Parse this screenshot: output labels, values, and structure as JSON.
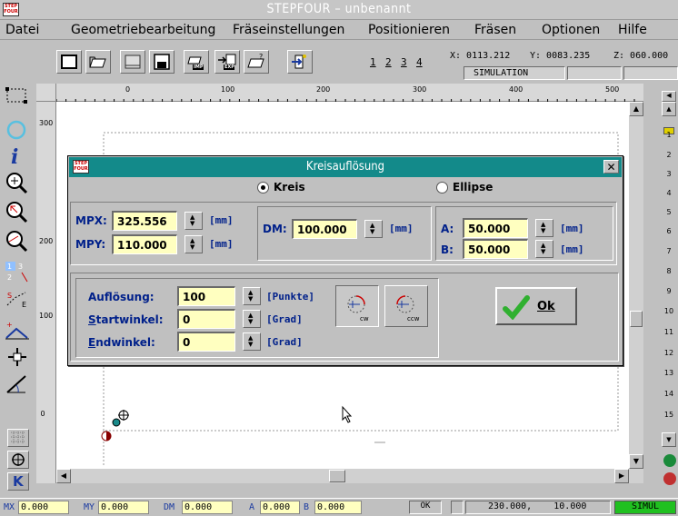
{
  "window": {
    "title": "STEPFOUR – unbenannt",
    "logo_text": "STEP FOUR"
  },
  "menu": [
    "Datei",
    "Geometriebearbeitung",
    "Fräseinstellungen",
    "Positionieren",
    "Fräsen",
    "Optionen",
    "Hilfe"
  ],
  "toolbar": {
    "page_numbers": [
      "1",
      "2",
      "3",
      "4"
    ],
    "imp_label": "IMP",
    "exp_label": "EXP",
    "coord_x": "X: 0113.212",
    "coord_y": "Y: 0083.235",
    "coord_z": "Z: 060.000",
    "mode": "SIMULATION"
  },
  "ruler": {
    "h_ticks": [
      "0",
      "100",
      "200",
      "300",
      "400",
      "500"
    ],
    "v_ticks": [
      "300",
      "200",
      "100",
      "0"
    ]
  },
  "right_numbers": [
    "1",
    "2",
    "3",
    "4",
    "5",
    "6",
    "7",
    "8",
    "9",
    "10",
    "11",
    "12",
    "13",
    "14",
    "15"
  ],
  "dialog": {
    "title": "Kreisauflösung",
    "logo_text": "STEP FOUR",
    "close": "✕",
    "radio_kreis": "Kreis",
    "radio_ellipse": "Ellipse",
    "mpx_label": "MPX:",
    "mpx_value": "325.556",
    "mpy_label": "MPY:",
    "mpy_value": "110.000",
    "unit_mm": "[mm]",
    "dm_label": "DM:",
    "dm_value": "100.000",
    "a_label": "A:",
    "a_value": "50.000",
    "b_label": "B:",
    "b_value": "50.000",
    "aufl_label": "Auflösung:",
    "aufl_value": "100",
    "aufl_unit": "[Punkte]",
    "start_label": "Startwinkel:",
    "start_value": "0",
    "end_label": "Endwinkel:",
    "end_value": "0",
    "unit_grad": "[Grad]",
    "cw": "cw",
    "ccw": "ccw",
    "ok": "Ok"
  },
  "status": {
    "mx_label": "MX",
    "mx_value": "0.000",
    "my_label": "MY",
    "my_value": "0.000",
    "dm_label": "DM",
    "dm_value": "0.000",
    "a_label": "A",
    "a_value": "0.000",
    "b_label": "B",
    "b_value": "0.000",
    "ok": "OK",
    "pos": "230.000,",
    "pos2": "10.000",
    "mode": "SIMUL"
  },
  "colors": {
    "dialog_title": "#138a8a",
    "field_bg": "#ffffc0",
    "label": "#00208a",
    "mode_bg": "#20c020"
  }
}
